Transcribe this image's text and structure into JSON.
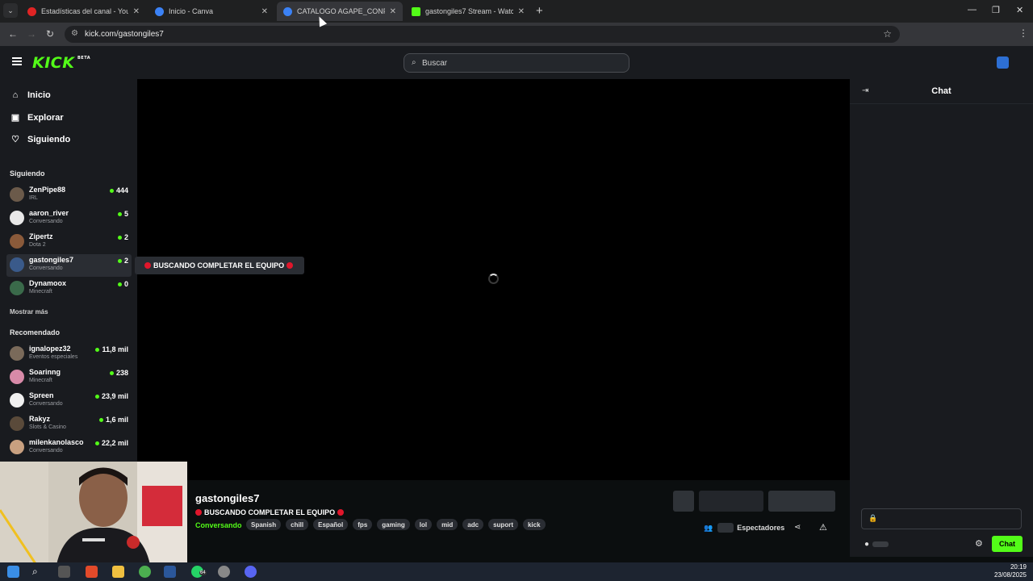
{
  "browser": {
    "tabs": [
      {
        "title": "Estadísticas del canal - YouTube",
        "favicon_color": "#e02424"
      },
      {
        "title": "Inicio - Canva",
        "favicon_color": "#3b82f6"
      },
      {
        "title": "CATALOGO AGAPE_CONFECCIO",
        "favicon_color": "#3b82f6"
      },
      {
        "title": "gastongiles7 Stream - Watch Li",
        "favicon_color": "#53fc18"
      }
    ],
    "url": "kick.com/gastongiles7"
  },
  "header": {
    "logo_text": "KICK",
    "logo_badge": "BETA",
    "search_placeholder": "Buscar"
  },
  "sidebar": {
    "nav": [
      {
        "label": "Inicio",
        "icon": "home-icon"
      },
      {
        "label": "Explorar",
        "icon": "explore-icon"
      },
      {
        "label": "Siguiendo",
        "icon": "heart-icon"
      }
    ],
    "following_header": "Siguiendo",
    "following": [
      {
        "name": "ZenPipe88",
        "category": "IRL",
        "viewers": "444",
        "avatar_color": "#6b5a4a"
      },
      {
        "name": "aaron_river",
        "category": "Conversando",
        "viewers": "5",
        "avatar_color": "#e8e8e8"
      },
      {
        "name": "Zipertz",
        "category": "Dota 2",
        "viewers": "2",
        "avatar_color": "#8a5a3a"
      },
      {
        "name": "gastongiles7",
        "category": "Conversando",
        "viewers": "2",
        "avatar_color": "#3a5a8a"
      },
      {
        "name": "Dynamoox",
        "category": "Minecraft",
        "viewers": "0",
        "avatar_color": "#3a6a4a"
      }
    ],
    "show_more": "Mostrar más",
    "recommended_header": "Recomendado",
    "recommended": [
      {
        "name": "ignalopez32",
        "category": "Eventos especiales",
        "viewers": "11,8 mil",
        "avatar_color": "#7a6a5a"
      },
      {
        "name": "Soarinng",
        "category": "Minecraft",
        "viewers": "238",
        "avatar_color": "#d88aa8"
      },
      {
        "name": "Spreen",
        "category": "Conversando",
        "viewers": "23,9 mil",
        "avatar_color": "#f0f0f0"
      },
      {
        "name": "Rakyz",
        "category": "Slots & Casino",
        "viewers": "1,6 mil",
        "avatar_color": "#5a4a3a"
      },
      {
        "name": "milenkanolasco",
        "category": "Conversando",
        "viewers": "22,2 mil",
        "avatar_color": "#c8a080"
      }
    ],
    "tooltip": "BUSCANDO COMPLETAR EL EQUIPO"
  },
  "stream": {
    "channel": "gastongiles7",
    "title": "BUSCANDO COMPLETAR EL EQUIPO",
    "category": "Conversando",
    "tags": [
      "Spanish",
      "chill",
      "Español",
      "fps",
      "gaming",
      "lol",
      "mid",
      "adc",
      "suport",
      "kick"
    ],
    "viewers_label": "Espectadores"
  },
  "chat": {
    "title": "Chat",
    "send_label": "Chat"
  },
  "taskbar": {
    "time": "20:19",
    "date": "23/08/2025",
    "whatsapp_badge": "64"
  },
  "colors": {
    "accent": "#53fc18",
    "live_dot": "#e0162b"
  }
}
